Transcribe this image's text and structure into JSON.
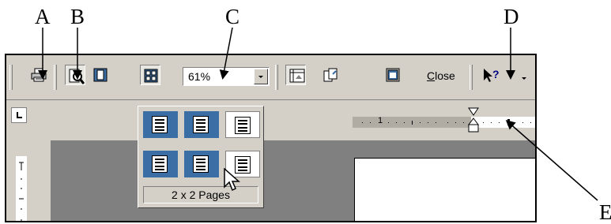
{
  "callouts": {
    "a": "A",
    "b": "B",
    "c": "C",
    "d": "D",
    "e": "E"
  },
  "toolbar": {
    "zoom_value": "61%",
    "close_label_mnemonic": "C",
    "close_label_rest": "lose"
  },
  "ruler": {
    "first_number": "1"
  },
  "multiple_pages_popup": {
    "grid_rows": 2,
    "grid_cols": 3,
    "selected": "2 x 2",
    "caption": "2 x 2 Pages"
  },
  "icons": [
    "printer-icon",
    "magnifier-icon",
    "one-page-icon",
    "multiple-pages-icon",
    "view-ruler-icon",
    "shrink-to-fit-icon",
    "full-screen-icon",
    "context-help-icon"
  ]
}
